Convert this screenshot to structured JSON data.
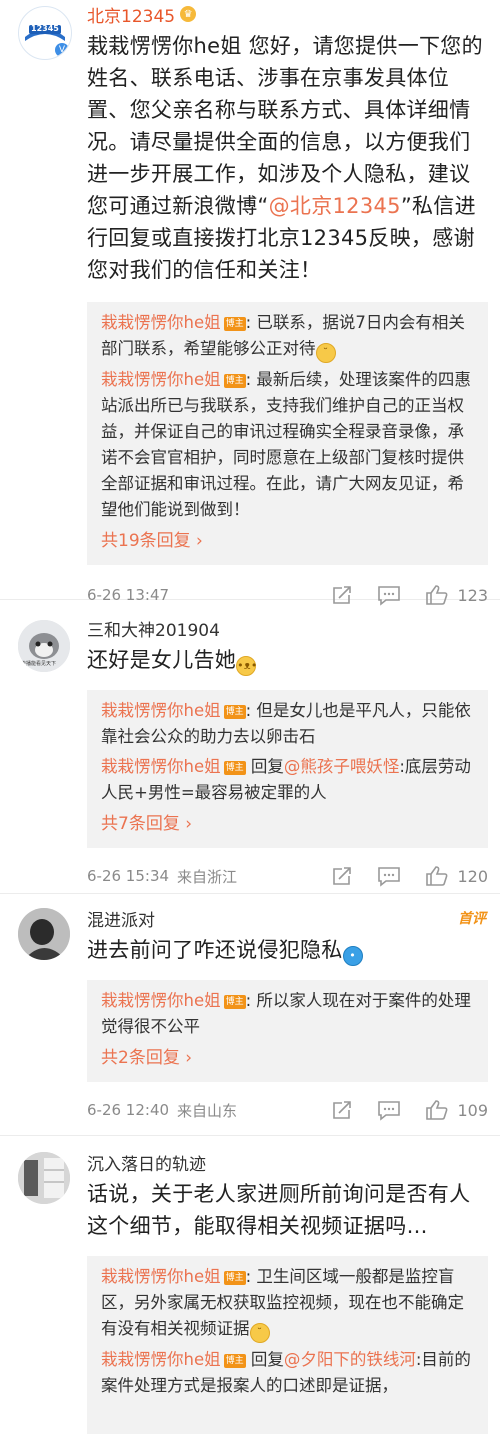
{
  "comments": [
    {
      "name": "北京12345",
      "content_parts": [
        "栽栽愣愣你he姐 您好，请您提供一下您的姓名、联系电话、涉事在京事发具体位置、您父亲名称与联系方式、具体详细情况。请尽量提供全面的信息，以方便我们进一步开展工作，如涉及个人隐私，建议您可通过新浪微博“",
        "@北京12345",
        "”私信进行回复或直接拨打北京12345反映，感谢您对我们的信任和关注！"
      ],
      "replies": [
        {
          "name": "栽栽愣愣你he姐",
          "badge": "博主",
          "text": ": 已联系，据说7日内会有相关部门联系，希望能够公正对待"
        },
        {
          "name": "栽栽愣愣你he姐",
          "badge": "博主",
          "text": ": 最新后续，处理该案件的四惠站派出所已与我联系，支持我们维护自己的正当权益，并保证自己的审讯过程确实全程录音录像，承诺不会官官相护，同时愿意在上级部门复核时提供全部证据和审讯过程。在此，请广大网友见证，希望他们能说到做到！"
        }
      ],
      "more": "共19条回复 ›",
      "time": "6-26 13:47",
      "location": "",
      "likes": "123"
    },
    {
      "name": "三和大神201904",
      "avatar_text": "传播能看见天下",
      "content": "还好是女儿告她",
      "replies": [
        {
          "name": "栽栽愣愣你he姐",
          "badge": "博主",
          "text": ": 但是女儿也是平凡人，只能依靠社会公众的助力去以卵击石"
        },
        {
          "name": "栽栽愣愣你he姐",
          "badge": "博主",
          "pre": " 回复",
          "mention": "@熊孩子喂妖怪",
          "text": ":底层劳动人民+男性=最容易被定罪的人"
        }
      ],
      "more": "共7条回复 ›",
      "time": "6-26 15:34",
      "location": "来自浙江",
      "likes": "120"
    },
    {
      "name": "混进派对",
      "tag": "首评",
      "content": "进去前问了咋还说侵犯隐私",
      "replies": [
        {
          "name": "栽栽愣愣你he姐",
          "badge": "博主",
          "text": ": 所以家人现在对于案件的处理觉得很不公平"
        }
      ],
      "more": "共2条回复 ›",
      "time": "6-26 12:40",
      "location": "来自山东",
      "likes": "109"
    },
    {
      "name": "沉入落日的轨迹",
      "content": "话说，关于老人家进厕所前询问是否有人这个细节，能取得相关视频证据吗…",
      "replies": [
        {
          "name": "栽栽愣愣你he姐",
          "badge": "博主",
          "text": ": 卫生间区域一般都是监控盲区，另外家属无权获取监控视频，现在也不能确定有没有相关视频证据"
        },
        {
          "name": "栽栽愣愣你he姐",
          "badge": "博主",
          "pre": " 回复",
          "mention": "@夕阳下的铁线河",
          "text": ":目前的案件处理方式是报案人的口述即是证据，"
        }
      ]
    }
  ]
}
